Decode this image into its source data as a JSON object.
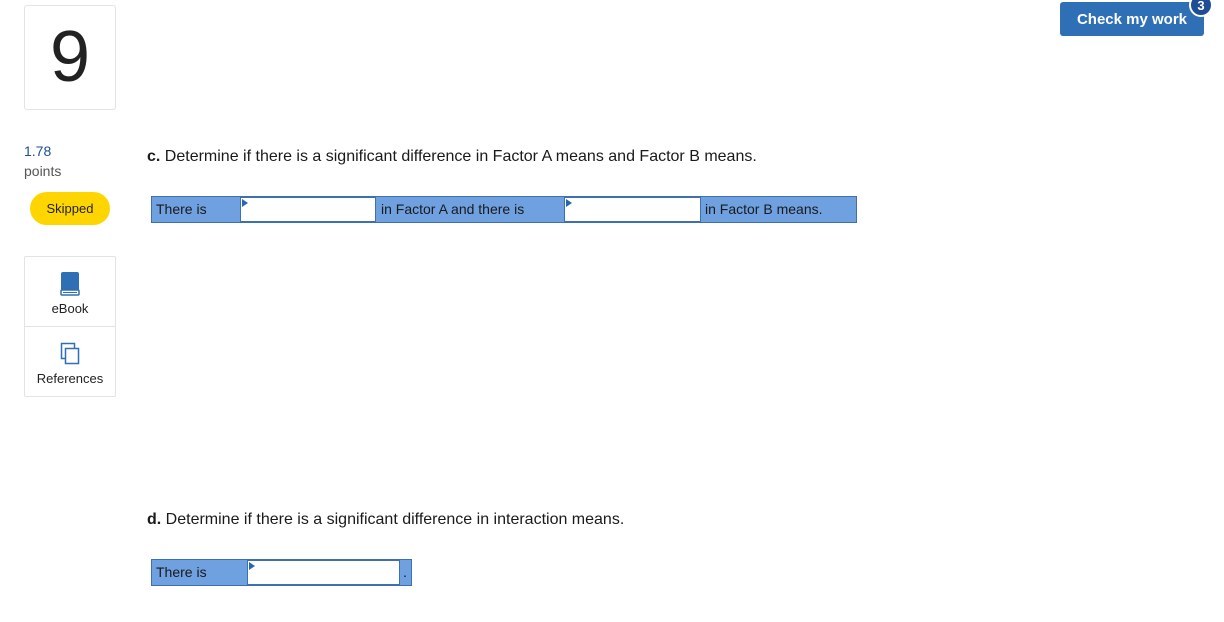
{
  "question": {
    "number": "9",
    "points_value": "1.78",
    "points_label": "points",
    "status": "Skipped"
  },
  "tools": {
    "ebook": {
      "label": "eBook",
      "icon": "book-icon"
    },
    "references": {
      "label": "References",
      "icon": "copy-icon"
    }
  },
  "header": {
    "check_button": "Check my work",
    "check_badge": "3"
  },
  "part_c": {
    "letter": "c.",
    "prompt": "Determine if there is a significant difference in Factor A means and Factor B means.",
    "segments": {
      "text1": "There is",
      "text2": "in Factor A and there is",
      "text3": "in Factor B means."
    },
    "dropdown1_value": "",
    "dropdown2_value": ""
  },
  "part_d": {
    "letter": "d.",
    "prompt": "Determine if there is a significant difference in interaction means.",
    "segments": {
      "text1": "There is",
      "end": "."
    },
    "dropdown1_value": ""
  },
  "colors": {
    "accent": "#2f6fb6",
    "badge": "#1f4e96",
    "skipped": "#ffd500",
    "answer_row": "#6fa0e0"
  }
}
